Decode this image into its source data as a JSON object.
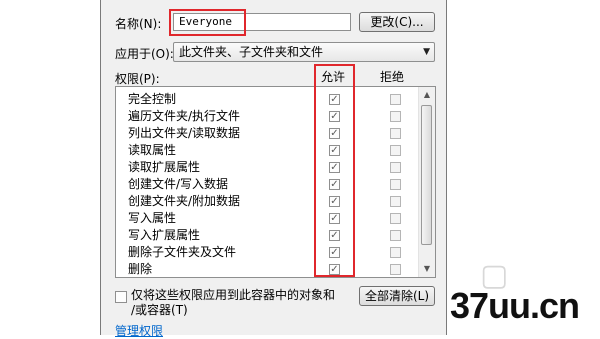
{
  "name_label": "名称(N):",
  "name_value": "Everyone",
  "change_button": "更改(C)...",
  "apply_to_label": "应用于(O):",
  "apply_to_value": "此文件夹、子文件夹和文件",
  "permissions_label": "权限(P):",
  "allow_header": "允许",
  "deny_header": "拒绝",
  "permissions": [
    {
      "name": "完全控制",
      "allow": true,
      "deny": false
    },
    {
      "name": "遍历文件夹/执行文件",
      "allow": true,
      "deny": false
    },
    {
      "name": "列出文件夹/读取数据",
      "allow": true,
      "deny": false
    },
    {
      "name": "读取属性",
      "allow": true,
      "deny": false
    },
    {
      "name": "读取扩展属性",
      "allow": true,
      "deny": false
    },
    {
      "name": "创建文件/写入数据",
      "allow": true,
      "deny": false
    },
    {
      "name": "创建文件夹/附加数据",
      "allow": true,
      "deny": false
    },
    {
      "name": "写入属性",
      "allow": true,
      "deny": false
    },
    {
      "name": "写入扩展属性",
      "allow": true,
      "deny": false
    },
    {
      "name": "删除子文件夹及文件",
      "allow": true,
      "deny": false
    },
    {
      "name": "删除",
      "allow": true,
      "deny": false
    }
  ],
  "apply_only_text": "仅将这些权限应用到此容器中的对象和\n/或容器(T)",
  "clear_all_button": "全部清除(L)",
  "manage_link": "管理权限",
  "watermark": "37uu.cn",
  "colors": {
    "highlight": "#e0272c",
    "link": "#0066cc"
  }
}
